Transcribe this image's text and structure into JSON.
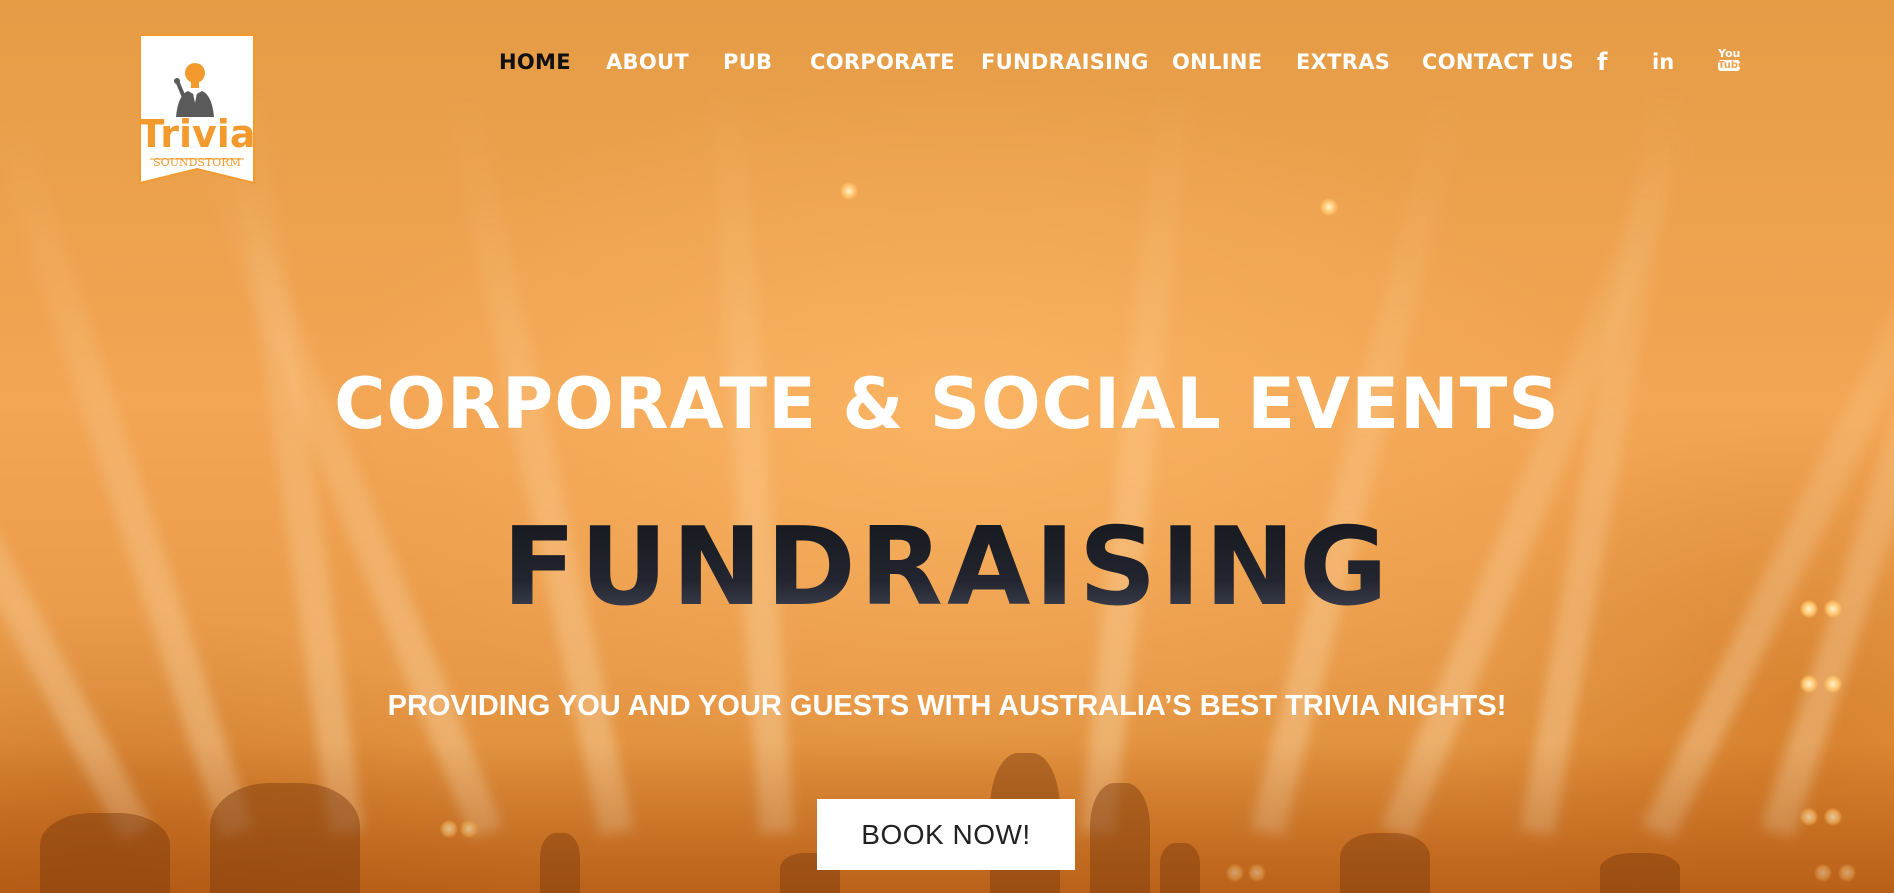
{
  "colors": {
    "brand_orange": "#f39a2e",
    "nav_active": "#111111",
    "nav_text": "#ffffff",
    "headline": "#ffffff",
    "subhead_dark": "#1c1e26",
    "button_bg": "#ffffff"
  },
  "logo": {
    "word": "Trivia",
    "sub_word": "SOUNDSTORM",
    "icon": "lightbulb-head-man-icon"
  },
  "nav": {
    "items": [
      {
        "label": "HOME",
        "active": true
      },
      {
        "label": "ABOUT",
        "active": false
      },
      {
        "label": "PUB",
        "active": false
      },
      {
        "label": "CORPORATE",
        "active": false
      },
      {
        "label": "FUNDRAISING",
        "active": false
      },
      {
        "label": "ONLINE",
        "active": false
      },
      {
        "label": "EXTRAS",
        "active": false
      },
      {
        "label": "CONTACT US",
        "active": false
      }
    ],
    "social": [
      {
        "icon": "facebook-icon",
        "glyph": "f"
      },
      {
        "icon": "linkedin-icon",
        "glyph": "in"
      },
      {
        "icon": "youtube-icon",
        "glyph_top": "You",
        "glyph_bottom": "Tube"
      }
    ]
  },
  "hero": {
    "headline": "CORPORATE & SOCIAL EVENTS",
    "subhead": "FUNDRAISING",
    "tagline": "PROVIDING YOU AND YOUR GUESTS WITH AUSTRALIA’S BEST TRIVIA NIGHTS!",
    "button_label": "BOOK NOW!"
  }
}
